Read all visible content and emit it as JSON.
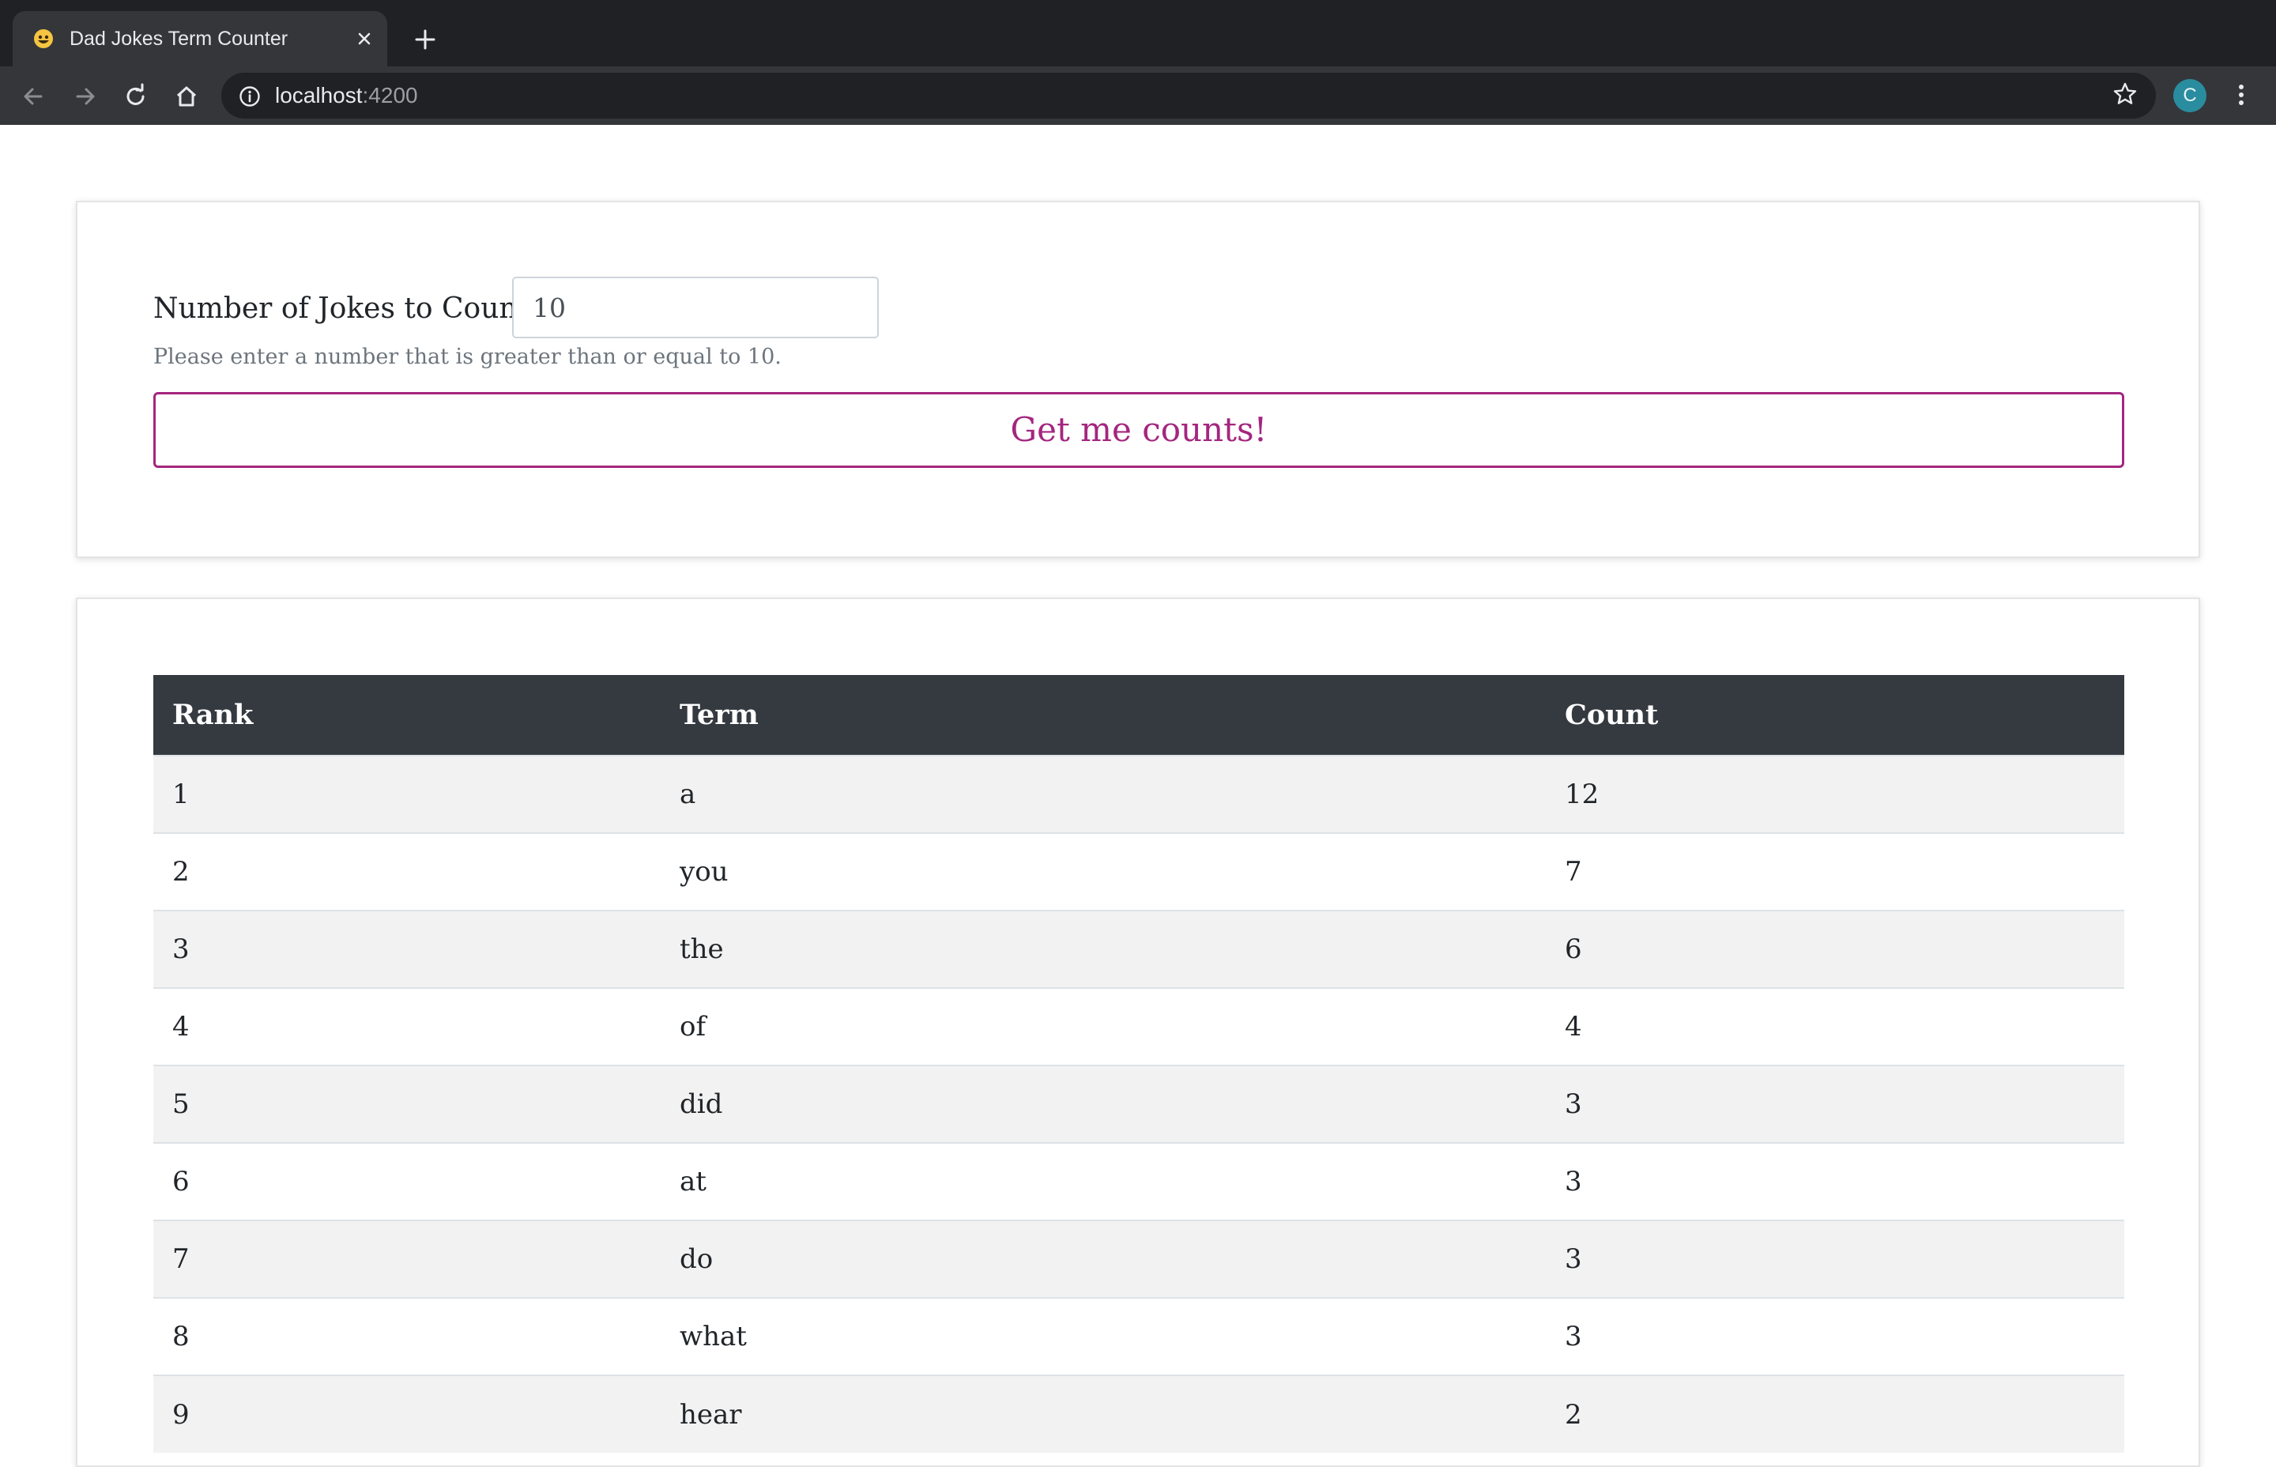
{
  "browser": {
    "tab_title": "Dad Jokes Term Counter",
    "url_host": "localhost",
    "url_port": ":4200",
    "avatar_letter": "C",
    "icons": {
      "favicon": "grinning-face-icon",
      "close": "close-icon",
      "new_tab": "plus-icon",
      "back": "back-arrow-icon",
      "forward": "forward-arrow-icon",
      "reload": "reload-icon",
      "home": "home-icon",
      "info": "info-icon",
      "bookmark": "star-icon",
      "menu": "kebab-menu-icon"
    }
  },
  "form": {
    "label": "Number of Jokes to Count:",
    "input_value": "10",
    "help_text": "Please enter a number that is greater than or equal to 10.",
    "button_label": "Get me counts!"
  },
  "table": {
    "headers": [
      "Rank",
      "Term",
      "Count"
    ],
    "rows": [
      [
        "1",
        "a",
        "12"
      ],
      [
        "2",
        "you",
        "7"
      ],
      [
        "3",
        "the",
        "6"
      ],
      [
        "4",
        "of",
        "4"
      ],
      [
        "5",
        "did",
        "3"
      ],
      [
        "6",
        "at",
        "3"
      ],
      [
        "7",
        "do",
        "3"
      ],
      [
        "8",
        "what",
        "3"
      ],
      [
        "9",
        "hear",
        "2"
      ]
    ]
  },
  "colors": {
    "accent": "#a4267f",
    "table_header": "#343a40",
    "stripe": "#f2f2f2",
    "chrome_dark": "#202124",
    "chrome_toolbar": "#35363a"
  }
}
